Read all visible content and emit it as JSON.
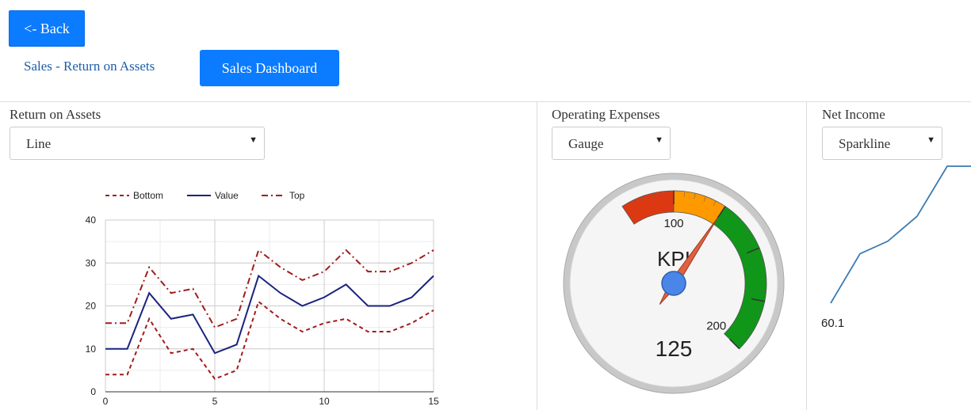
{
  "nav": {
    "back_label": "<- Back",
    "breadcrumb_label": "Sales - Return on Assets",
    "active_tab_label": "Sales Dashboard"
  },
  "panels": {
    "roa": {
      "title": "Return on Assets",
      "chart_type": "Line"
    },
    "opex": {
      "title": "Operating Expenses",
      "chart_type": "Gauge"
    },
    "net_income": {
      "title": "Net Income",
      "chart_type": "Sparkline"
    }
  },
  "colors": {
    "accent": "#0b7bff",
    "bottom_series": "#a11c1c",
    "value_series": "#1a237e",
    "top_series": "#a11c1c",
    "gauge_red": "#dc3912",
    "gauge_orange": "#ff9900",
    "gauge_green": "#109618",
    "sparkline": "#3a7ab3"
  },
  "chart_data": [
    {
      "type": "line",
      "x": [
        0,
        1,
        2,
        3,
        4,
        5,
        6,
        7,
        8,
        9,
        10,
        11,
        12,
        13,
        14,
        15
      ],
      "series": [
        {
          "name": "Bottom",
          "values": [
            4,
            4,
            17,
            9,
            10,
            3,
            5,
            21,
            17,
            14,
            16,
            17,
            14,
            14,
            16,
            19
          ]
        },
        {
          "name": "Value",
          "values": [
            10,
            10,
            23,
            17,
            18,
            9,
            11,
            27,
            23,
            20,
            22,
            25,
            20,
            20,
            22,
            27
          ]
        },
        {
          "name": "Top",
          "values": [
            16,
            16,
            29,
            23,
            24,
            15,
            17,
            33,
            29,
            26,
            28,
            33,
            28,
            28,
            30,
            33
          ]
        }
      ],
      "xticks": [
        "0",
        "5",
        "10",
        "15"
      ],
      "yticks": [
        "0",
        "10",
        "20",
        "30",
        "40"
      ],
      "xlim": [
        0,
        15
      ],
      "ylim": [
        0,
        40
      ],
      "grid": true,
      "legend": "top"
    },
    {
      "type": "gauge",
      "label": "KPI",
      "value": 125,
      "value_label": "125",
      "ticks": [
        "100",
        "200"
      ],
      "bands": [
        {
          "color": "red",
          "from": 75,
          "to": 100
        },
        {
          "color": "orange",
          "from": 100,
          "to": 125
        },
        {
          "color": "green",
          "from": 125,
          "to": 200
        }
      ]
    },
    {
      "type": "line",
      "subtype": "sparkline",
      "values": [
        60.1,
        68,
        70,
        74,
        82,
        82
      ],
      "min_label": "60.1"
    }
  ]
}
